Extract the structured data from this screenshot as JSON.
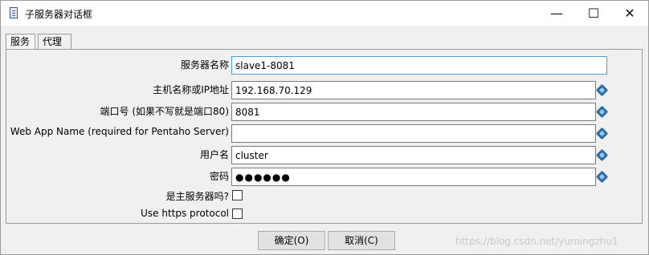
{
  "window": {
    "title": "子服务器对话框",
    "controls": {
      "minimize": "—",
      "maximize": "☐",
      "close": "✕"
    }
  },
  "tabs": [
    {
      "label": "服务",
      "active": true
    },
    {
      "label": "代理",
      "active": false
    }
  ],
  "form": {
    "server_name": {
      "label": "服务器名称",
      "value": "slave1-8081"
    },
    "hostname": {
      "label": "主机名称或IP地址",
      "value": "192.168.70.129"
    },
    "port": {
      "label": "端口号 (如果不写就是端口80)",
      "value": "8081"
    },
    "web_app_name": {
      "label": "Web App Name (required for Pentaho Server)",
      "value": ""
    },
    "username": {
      "label": "用户名",
      "value": "cluster"
    },
    "password": {
      "label": "密码",
      "value": "●●●●●●"
    },
    "is_master": {
      "label": "是主服务器吗?",
      "checked": false
    },
    "use_https": {
      "label": "Use https protocol",
      "checked": false
    }
  },
  "buttons": {
    "ok": "确定(O)",
    "cancel": "取消(C)"
  },
  "watermark": "https://blog.csdn.net/yumingzhu1",
  "colors": {
    "variable_icon": "#2e6ea6",
    "focus_border": "#4aa3c9"
  }
}
